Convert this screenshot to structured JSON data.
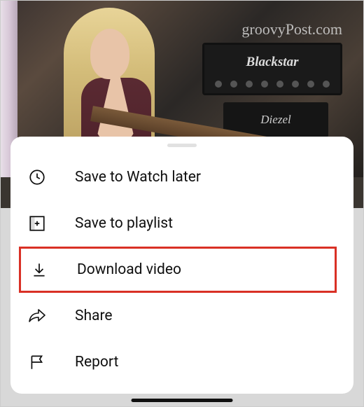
{
  "watermark": "groovyPost.com",
  "amp_brand_1": "Blackstar",
  "amp_brand_2": "Diezel",
  "menu": {
    "items": [
      {
        "label": "Save to Watch later"
      },
      {
        "label": "Save to playlist"
      },
      {
        "label": "Download video"
      },
      {
        "label": "Share"
      },
      {
        "label": "Report"
      }
    ]
  }
}
